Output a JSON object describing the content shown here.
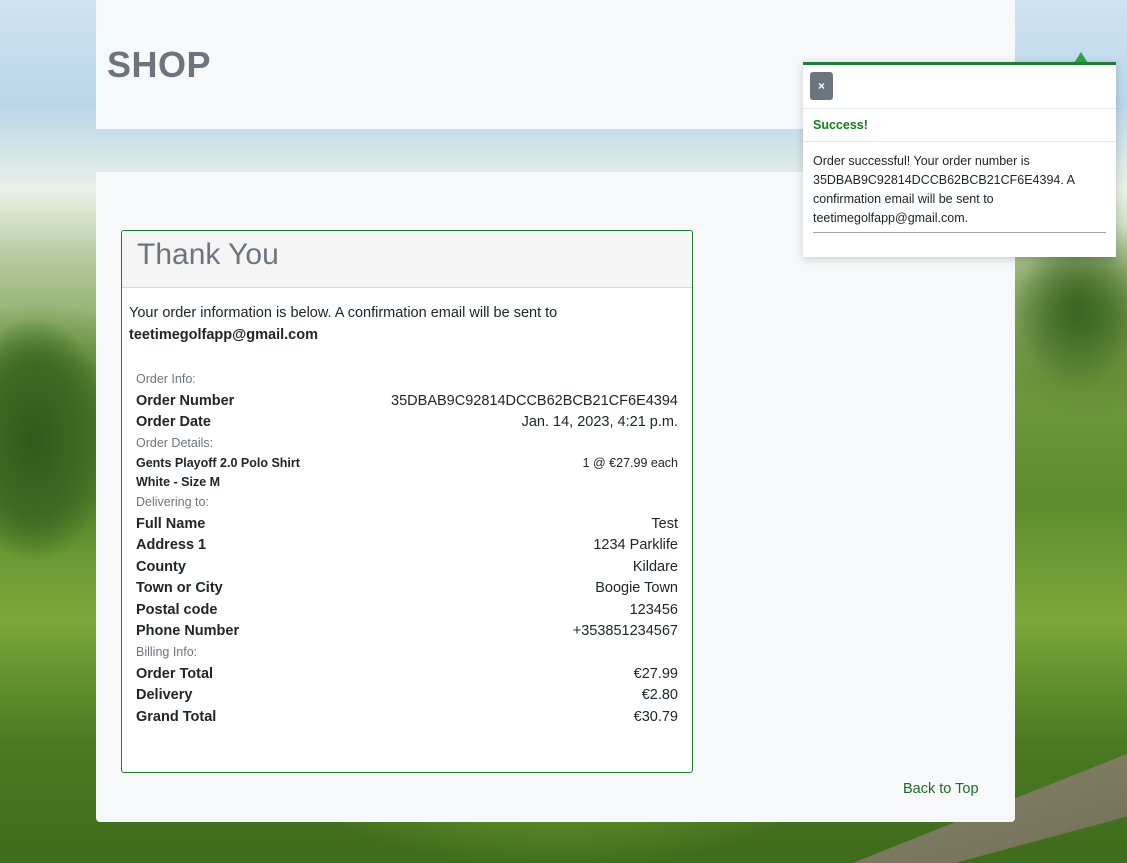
{
  "page": {
    "title": "SHOP"
  },
  "card": {
    "title": "Thank You",
    "intro": "Your order information is below. A confirmation email will be sent to",
    "email": "teetimegolfapp@gmail.com",
    "sections": {
      "order_info": "Order Info:",
      "order_details": "Order Details:",
      "delivering_to": "Delivering to:",
      "billing_info": "Billing Info:"
    },
    "order": {
      "number_label": "Order Number",
      "number": "35DBAB9C92814DCCB62BCB21CF6E4394",
      "date_label": "Order Date",
      "date": "Jan. 14, 2023, 4:21 p.m."
    },
    "item": {
      "name": "Gents Playoff 2.0 Polo Shirt",
      "qty_price": "1 @ €27.99 each",
      "variant": "White - Size M"
    },
    "delivery": [
      {
        "label": "Full Name",
        "value": "Test"
      },
      {
        "label": "Address 1",
        "value": "1234 Parklife"
      },
      {
        "label": "County",
        "value": "Kildare"
      },
      {
        "label": "Town or City",
        "value": "Boogie Town"
      },
      {
        "label": "Postal code",
        "value": "123456"
      },
      {
        "label": "Phone Number",
        "value": "+353851234567"
      }
    ],
    "billing": [
      {
        "label": "Order Total",
        "value": "€27.99"
      },
      {
        "label": "Delivery",
        "value": "€2.80"
      },
      {
        "label": "Grand Total",
        "value": "€30.79"
      }
    ]
  },
  "footer": {
    "back_to_top": "Back to Top"
  },
  "toast": {
    "close_label": "×",
    "status": "Success!",
    "message": "Order successful! Your order number is 35DBAB9C92814DCCB62BCB21CF6E4394. A confirmation email will be sent to teetimegolfapp@gmail.com.",
    "accent_color": "#1e7e34"
  },
  "colors": {
    "accent": "#1e7e34",
    "success_text": "#167c1c",
    "muted": "#6c757d",
    "panel": "#f7f8f9"
  }
}
